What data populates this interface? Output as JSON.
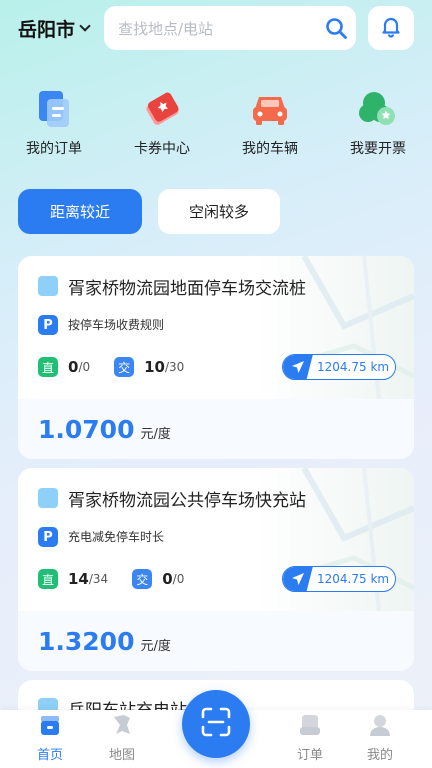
{
  "header": {
    "city": "岳阳市",
    "search_placeholder": "查找地点/电站"
  },
  "shortcuts": [
    {
      "label": "我的订单",
      "icon": "order-icon"
    },
    {
      "label": "卡券中心",
      "icon": "coupon-icon"
    },
    {
      "label": "我的车辆",
      "icon": "car-icon"
    },
    {
      "label": "我要开票",
      "icon": "invoice-icon"
    }
  ],
  "tabs": [
    {
      "label": "距离较近",
      "active": true
    },
    {
      "label": "空闲较多",
      "active": false
    }
  ],
  "stations": [
    {
      "name": "胥家桥物流园地面停车场交流桩",
      "parking_rule": "按停车场收费规则",
      "direct_label": "直",
      "direct_free": "0",
      "direct_total": "0",
      "ac_label": "交",
      "ac_free": "10",
      "ac_total": "30",
      "distance": "1204.75 km",
      "price": "1.0700",
      "unit": "元/度"
    },
    {
      "name": "胥家桥物流园公共停车场快充站",
      "parking_rule": "充电减免停车时长",
      "direct_label": "直",
      "direct_free": "14",
      "direct_total": "34",
      "ac_label": "交",
      "ac_free": "0",
      "ac_total": "0",
      "distance": "1204.75 km",
      "price": "1.3200",
      "unit": "元/度"
    },
    {
      "name": "岳阳东站充电站"
    }
  ],
  "nav": {
    "home": "首页",
    "map": "地图",
    "orders": "订单",
    "mine": "我的"
  },
  "colors": {
    "accent": "#2b7cf1",
    "direct": "#1fbf75",
    "ac": "#3b86f3"
  }
}
